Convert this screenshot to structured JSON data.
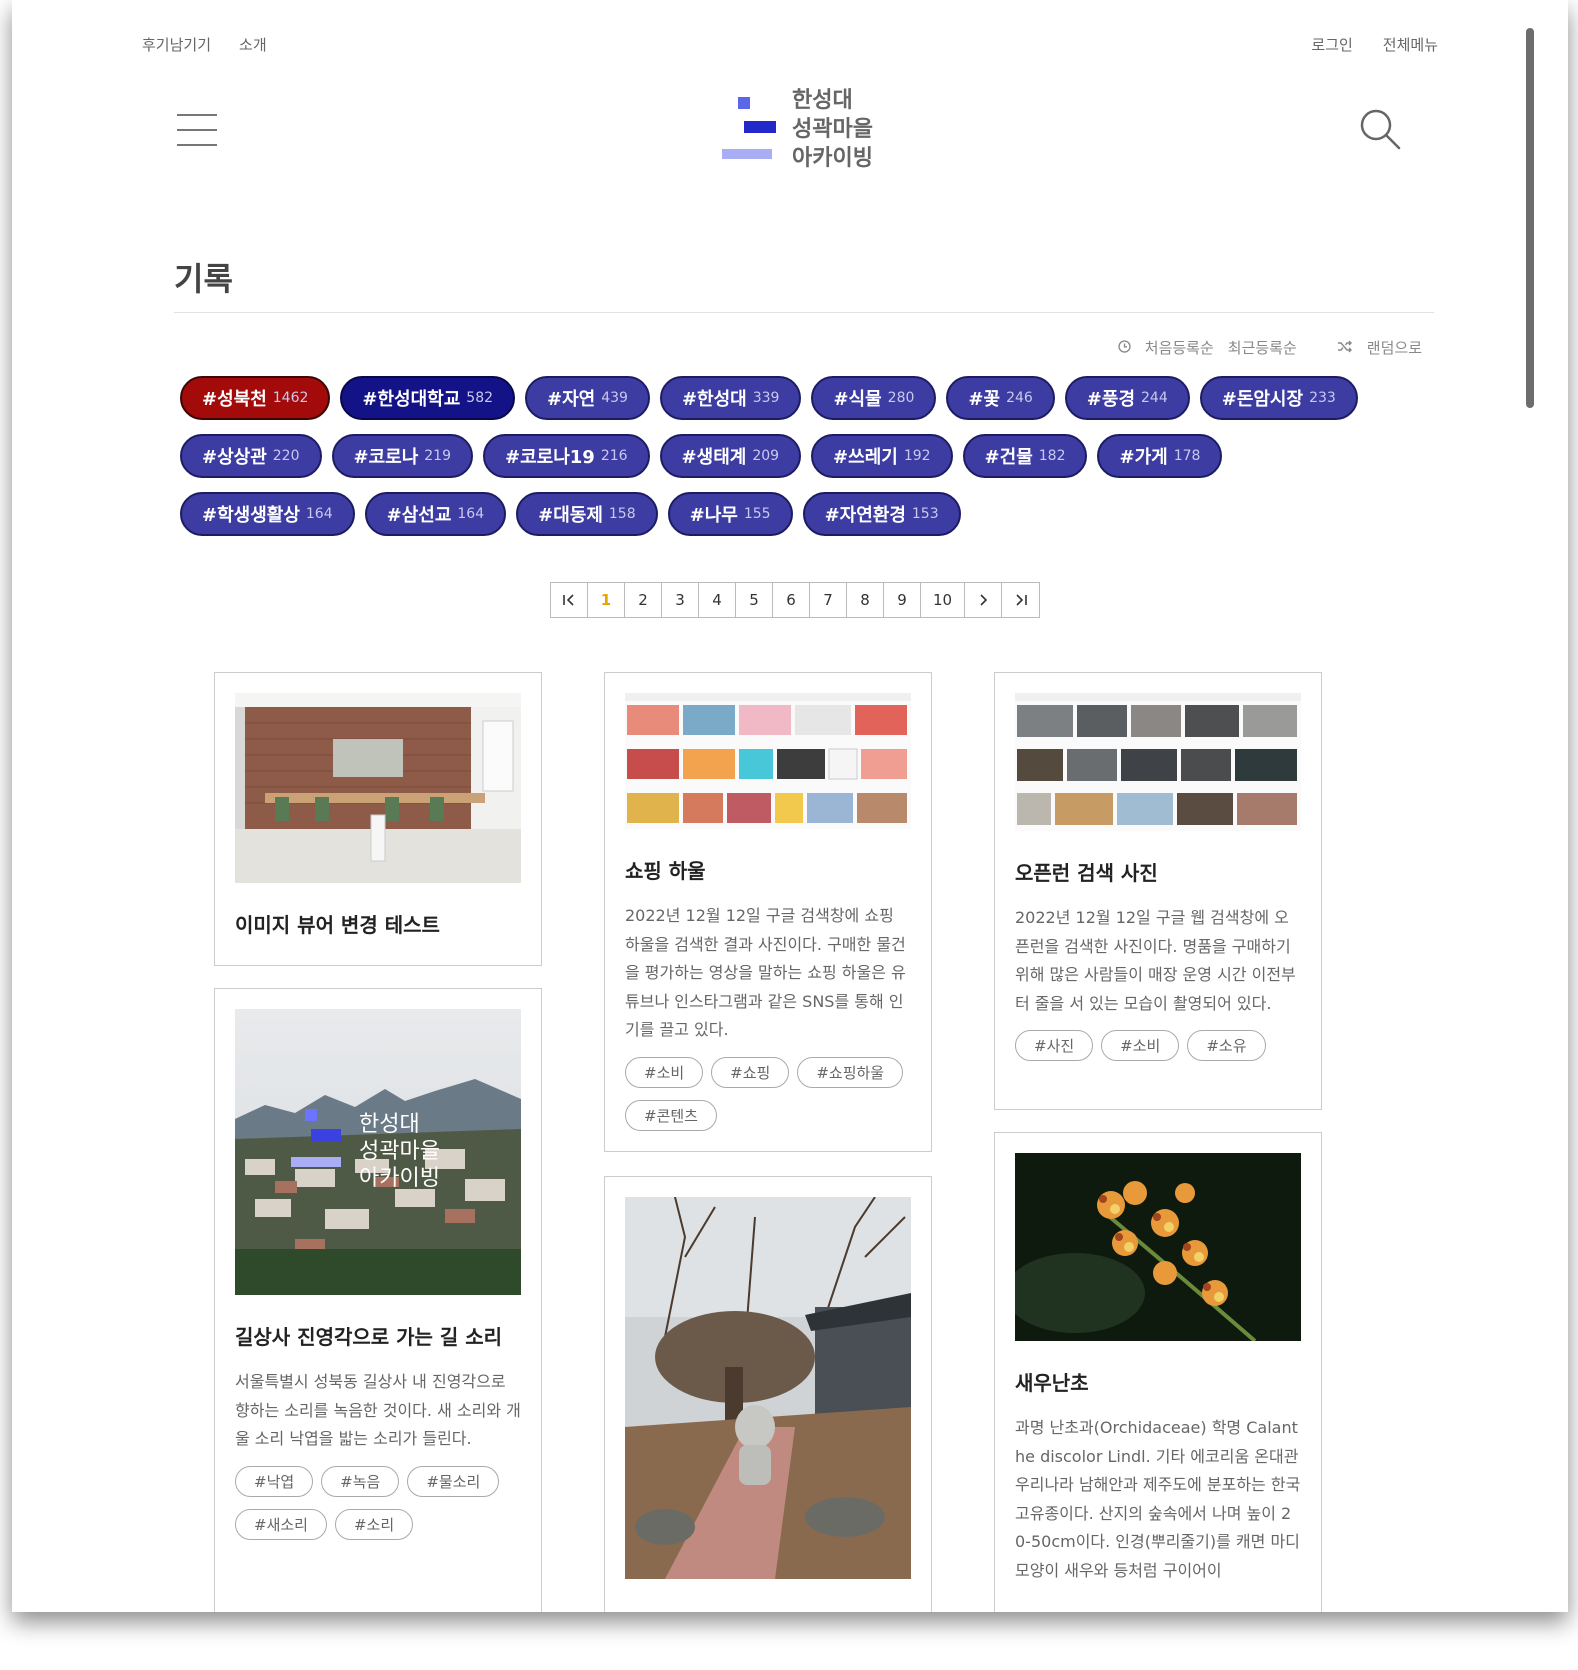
{
  "util": {
    "left": [
      "후기남기기",
      "소개"
    ],
    "right": [
      "로그인",
      "전체메뉴"
    ]
  },
  "logo": {
    "line1": "한성대",
    "line2": "성곽마을",
    "line3": "아카이빙"
  },
  "page_title": "기록",
  "sort": {
    "first": "처음등록순",
    "recent": "최근등록순",
    "random": "랜덤으로"
  },
  "tags": [
    {
      "label": "#성북천",
      "count": "1462",
      "style": "red"
    },
    {
      "label": "#한성대학교",
      "count": "582",
      "style": "navy"
    },
    {
      "label": "#자연",
      "count": "439",
      "style": "default"
    },
    {
      "label": "#한성대",
      "count": "339",
      "style": "default"
    },
    {
      "label": "#식물",
      "count": "280",
      "style": "default"
    },
    {
      "label": "#꽃",
      "count": "246",
      "style": "default"
    },
    {
      "label": "#풍경",
      "count": "244",
      "style": "default"
    },
    {
      "label": "#돈암시장",
      "count": "233",
      "style": "default"
    },
    {
      "label": "#상상관",
      "count": "220",
      "style": "default"
    },
    {
      "label": "#코로나",
      "count": "219",
      "style": "default"
    },
    {
      "label": "#코로나19",
      "count": "216",
      "style": "default"
    },
    {
      "label": "#생태계",
      "count": "209",
      "style": "default"
    },
    {
      "label": "#쓰레기",
      "count": "192",
      "style": "default"
    },
    {
      "label": "#건물",
      "count": "182",
      "style": "default"
    },
    {
      "label": "#가게",
      "count": "178",
      "style": "default"
    },
    {
      "label": "#학생생활상",
      "count": "164",
      "style": "default"
    },
    {
      "label": "#삼선교",
      "count": "164",
      "style": "default"
    },
    {
      "label": "#대동제",
      "count": "158",
      "style": "default"
    },
    {
      "label": "#나무",
      "count": "155",
      "style": "default"
    },
    {
      "label": "#자연환경",
      "count": "153",
      "style": "default"
    }
  ],
  "pagination": {
    "pages": [
      "1",
      "2",
      "3",
      "4",
      "5",
      "6",
      "7",
      "8",
      "9",
      "10"
    ],
    "current": "1"
  },
  "cards": {
    "c1": {
      "title": "이미지 뷰어 변경 테스트"
    },
    "c2": {
      "title": "길상사 진영각으로 가는 길 소리",
      "desc": "서울특별시 성북동 길상사 내 진영각으로 향하는 소리를 녹음한 것이다. 새 소리와 개울 소리 낙엽을 밟는 소리가 들린다.",
      "tags": [
        "#낙엽",
        "#녹음",
        "#물소리",
        "#새소리",
        "#소리"
      ],
      "overlay": {
        "line1": "한성대",
        "line2": "성곽마을",
        "line3": "아카이빙"
      }
    },
    "c3": {
      "title": "쇼핑 하울",
      "desc": "2022년 12월 12일 구글 검색창에 쇼핑 하울을 검색한 결과 사진이다. 구매한 물건을 평가하는 영상을 말하는 쇼핑 하울은 유튜브나 인스타그램과 같은 SNS를 통해 인기를 끌고 있다.",
      "tags": [
        "#소비",
        "#쇼핑",
        "#쇼핑하울",
        "#콘텐츠"
      ]
    },
    "c5": {
      "title": "오픈런 검색 사진",
      "desc": "2022년 12월 12일 구글 웹 검색창에 오픈런을 검색한 사진이다. 명품을 구매하기 위해 많은 사람들이 매장 운영 시간 이전부터 줄을 서 있는 모습이 촬영되어 있다.",
      "tags": [
        "#사진",
        "#소비",
        "#소유"
      ]
    },
    "c6": {
      "title": "새우난초",
      "desc": "과명 난초과(Orchidaceae) 학명 Calanthe discolor Lindl. 기타 에코리움 온대관 우리나라 남해안과 제주도에 분포하는 한국 고유종이다. 산지의 숲속에서 나며 높이 20-50cm이다. 인경(뿌리줄기)를 캐면 마디 모양이 새우와 등처럼 구이어이"
    }
  },
  "colors": {
    "tag": "#3d3ca3",
    "tag_red": "#a30b0b",
    "tag_navy": "#131286",
    "active_page": "#e3a700"
  }
}
